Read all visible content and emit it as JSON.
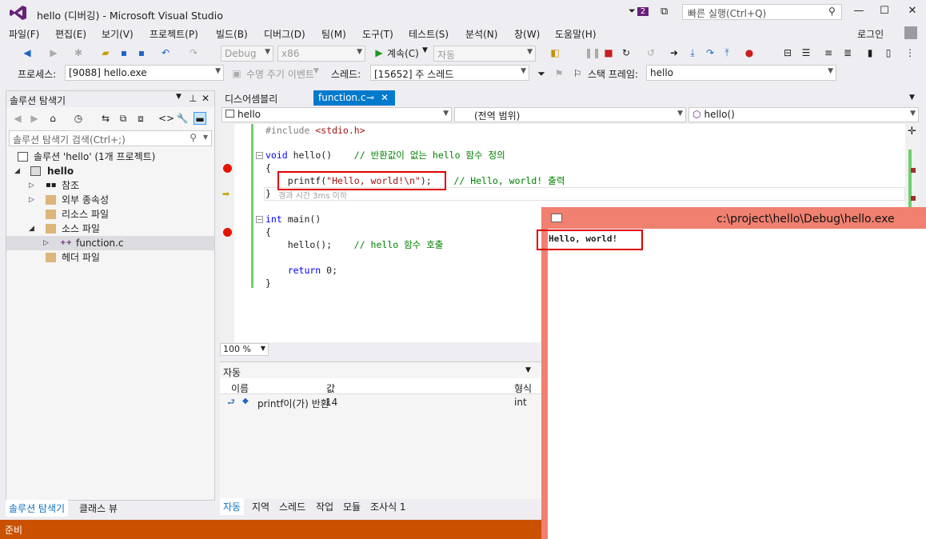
{
  "window": {
    "title": "hello (디버깅) - Microsoft Visual Studio",
    "notification_count": "2",
    "quick_launch_placeholder": "빠른 실행(Ctrl+Q)",
    "login": "로그인"
  },
  "menu": [
    "파일(F)",
    "편집(E)",
    "보기(V)",
    "프로젝트(P)",
    "빌드(B)",
    "디버그(D)",
    "팀(M)",
    "도구(T)",
    "테스트(S)",
    "분석(N)",
    "창(W)",
    "도움말(H)"
  ],
  "toolbar": {
    "config": "Debug",
    "platform": "x86",
    "continue": "계속(C)",
    "auto": "자동"
  },
  "debug_location": {
    "process_label": "프로세스:",
    "process_value": "[9088] hello.exe",
    "lifecycle_label": "수명 주기 이벤트",
    "thread_label": "스레드:",
    "thread_value": "[15652] 주 스레드",
    "stackframe_label": "스택 프레임:",
    "stackframe_value": "hello"
  },
  "solution_explorer": {
    "title": "솔루션 탐색기",
    "search_placeholder": "솔루션 탐색기 검색(Ctrl+;)",
    "solution": "솔루션 'hello' (1개 프로젝트)",
    "project": "hello",
    "references": "참조",
    "external_deps": "외부 종속성",
    "resource_files": "리소스 파일",
    "source_files": "소스 파일",
    "function_c": "function.c",
    "header_files": "헤더 파일",
    "tab_solution": "솔루션 탐색기",
    "tab_class": "클래스 뷰"
  },
  "doc_tabs": {
    "disassembly": "디스어셈블리",
    "function_c": "function.c"
  },
  "navbar": {
    "project": "hello",
    "scope": "(전역 범위)",
    "member": "hello()"
  },
  "code": {
    "l1_pp": "#include ",
    "l1_hdr": "<stdio.h>",
    "l2_kw": "void",
    "l2_rest": " hello()    ",
    "l2_cm": "// 반환값이 없는 hello 함수 정의",
    "l3": "{",
    "l4_fn": "    printf(",
    "l4_str": "\"Hello, world!\\n\"",
    "l4_end": ");",
    "l4_cm": "    // Hello, world! 출력",
    "l5": "}",
    "perf_tip": "경과 시간 3ms 이하",
    "l6_kw": "int",
    "l6_rest": " main()",
    "l7": "{",
    "l8_fn": "    hello();    ",
    "l8_cm": "// hello 함수 호출",
    "l9_kw": "    return",
    "l9_rest": " 0;",
    "l10": "}"
  },
  "zoom": "100 %",
  "autos": {
    "title": "자동",
    "col_name": "이름",
    "col_value": "값",
    "col_type": "형식",
    "row_name": "printf이(가) 반환",
    "row_value": "14",
    "row_type": "int",
    "tabs": [
      "자동",
      "지역",
      "스레드",
      "작업",
      "모듈",
      "조사식 1"
    ]
  },
  "status": "준비",
  "console": {
    "title": "c:\\project\\hello\\Debug\\hello.exe",
    "output": "Hello, world!"
  }
}
